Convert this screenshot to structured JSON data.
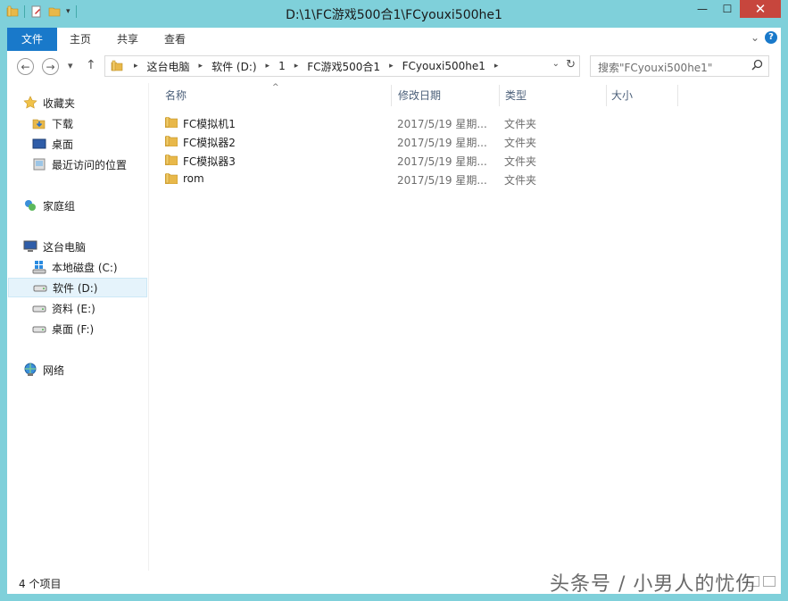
{
  "window": {
    "title": "D:\\1\\FC游戏500合1\\FCyouxi500he1",
    "minimize": "—",
    "maximize": "☐",
    "close": "✕"
  },
  "ribbon": {
    "tabs": [
      {
        "label": "文件"
      },
      {
        "label": "主页"
      },
      {
        "label": "共享"
      },
      {
        "label": "查看"
      }
    ],
    "expand_glyph": "⌄",
    "help_glyph": "?"
  },
  "nav": {
    "back": "←",
    "forward": "→",
    "recent": "▾",
    "up": "↑"
  },
  "address": {
    "crumbs": [
      "这台电脑",
      "软件 (D:)",
      "1",
      "FC游戏500合1",
      "FCyouxi500he1"
    ],
    "sep": "▸",
    "drop": "⌄",
    "refresh": "↻"
  },
  "search": {
    "placeholder": "搜索\"FCyouxi500he1\"",
    "icon": "search-icon"
  },
  "sidebar": {
    "items": [
      {
        "label": "收藏夹",
        "icon": "star-icon"
      },
      {
        "label": "下载",
        "icon": "download-folder-icon"
      },
      {
        "label": "桌面",
        "icon": "desktop-icon"
      },
      {
        "label": "最近访问的位置",
        "icon": "recent-places-icon"
      },
      {
        "label": "家庭组",
        "icon": "homegroup-icon"
      },
      {
        "label": "这台电脑",
        "icon": "computer-icon"
      },
      {
        "label": "本地磁盘 (C:)",
        "icon": "windows-drive-icon"
      },
      {
        "label": "软件 (D:)",
        "icon": "drive-icon",
        "selected": true
      },
      {
        "label": "资料 (E:)",
        "icon": "drive-icon"
      },
      {
        "label": "桌面 (F:)",
        "icon": "drive-icon"
      },
      {
        "label": "网络",
        "icon": "network-icon"
      }
    ]
  },
  "columns": {
    "name": "名称",
    "date": "修改日期",
    "type": "类型",
    "size": "大小",
    "sort_glyph": "^"
  },
  "files": [
    {
      "name": "FC模拟机1",
      "date": "2017/5/19 星期...",
      "type": "文件夹"
    },
    {
      "name": "FC模拟器2",
      "date": "2017/5/19 星期...",
      "type": "文件夹"
    },
    {
      "name": "FC模拟器3",
      "date": "2017/5/19 星期...",
      "type": "文件夹"
    },
    {
      "name": "rom",
      "date": "2017/5/19 星期...",
      "type": "文件夹"
    }
  ],
  "status": {
    "count": "4 个项目"
  },
  "watermark": "头条号 / 小男人的忧伤",
  "colors": {
    "frame": "#7fd0da",
    "file_tab": "#1979ca",
    "close": "#c7463d",
    "selection": "#e5f3fb",
    "folder": "#e8b84a"
  }
}
